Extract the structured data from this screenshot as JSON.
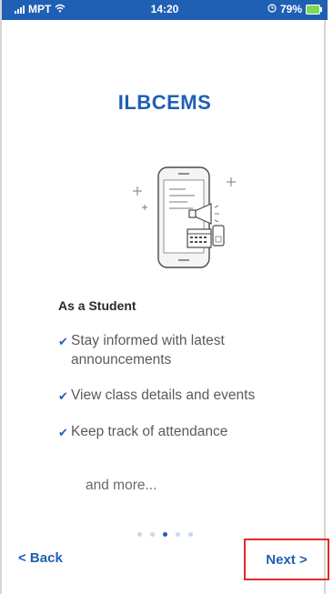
{
  "status_bar": {
    "carrier": "MPT",
    "time": "14:20",
    "battery": "79%"
  },
  "app": {
    "title": "ILBCEMS"
  },
  "onboarding": {
    "heading": "As a Student",
    "features": [
      "Stay informed with latest announcements",
      "View class details and events",
      "Keep track of attendance"
    ],
    "more": "and more...",
    "pager": {
      "total": 5,
      "current": 3
    }
  },
  "nav": {
    "back_label": "< Back",
    "next_label": "Next >"
  },
  "colors": {
    "brand": "#1f5fb4",
    "highlight": "#e02b2b"
  }
}
